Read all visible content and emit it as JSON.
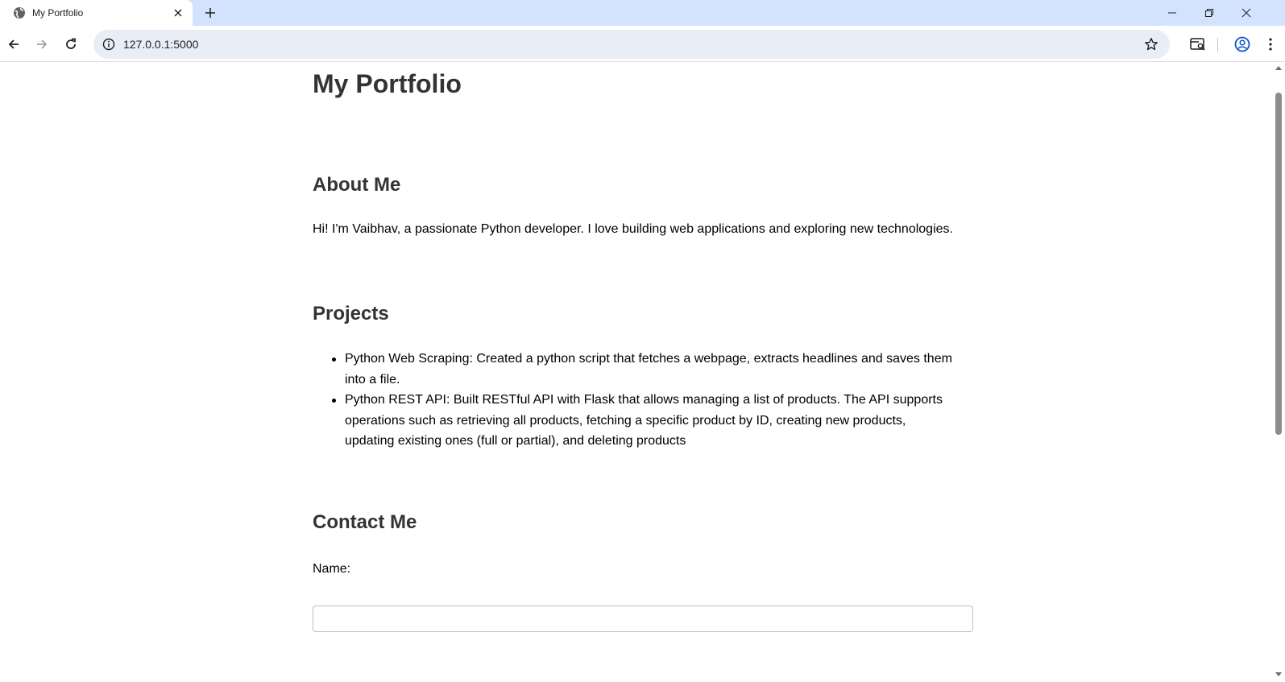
{
  "browser": {
    "tab_title": "My Portfolio",
    "url": "127.0.0.1:5000",
    "icons": {
      "favicon": "globe-icon",
      "close": "close-icon",
      "new_tab": "plus-icon",
      "back": "arrow-left-icon",
      "forward": "arrow-right-icon",
      "reload": "reload-icon",
      "site_info": "info-icon",
      "bookmark": "star-icon",
      "tab_search": "tab-search-icon",
      "profile": "profile-icon",
      "menu": "kebab-menu-icon"
    },
    "accent_color": "#d3e3fd"
  },
  "page": {
    "title": "My Portfolio",
    "about": {
      "heading": "About Me",
      "text": "Hi! I'm Vaibhav, a passionate Python developer. I love building web applications and exploring new technologies."
    },
    "projects": {
      "heading": "Projects",
      "items": [
        "Python Web Scraping: Created a python script that fetches a webpage, extracts headlines and saves them into a file.",
        "Python REST API: Built RESTful API with Flask that allows managing a list of products. The API supports operations such as retrieving all products, fetching a specific product by ID, creating new products, updating existing ones (full or partial), and deleting products"
      ]
    },
    "contact": {
      "heading": "Contact Me",
      "name_label": "Name:",
      "name_value": ""
    }
  }
}
